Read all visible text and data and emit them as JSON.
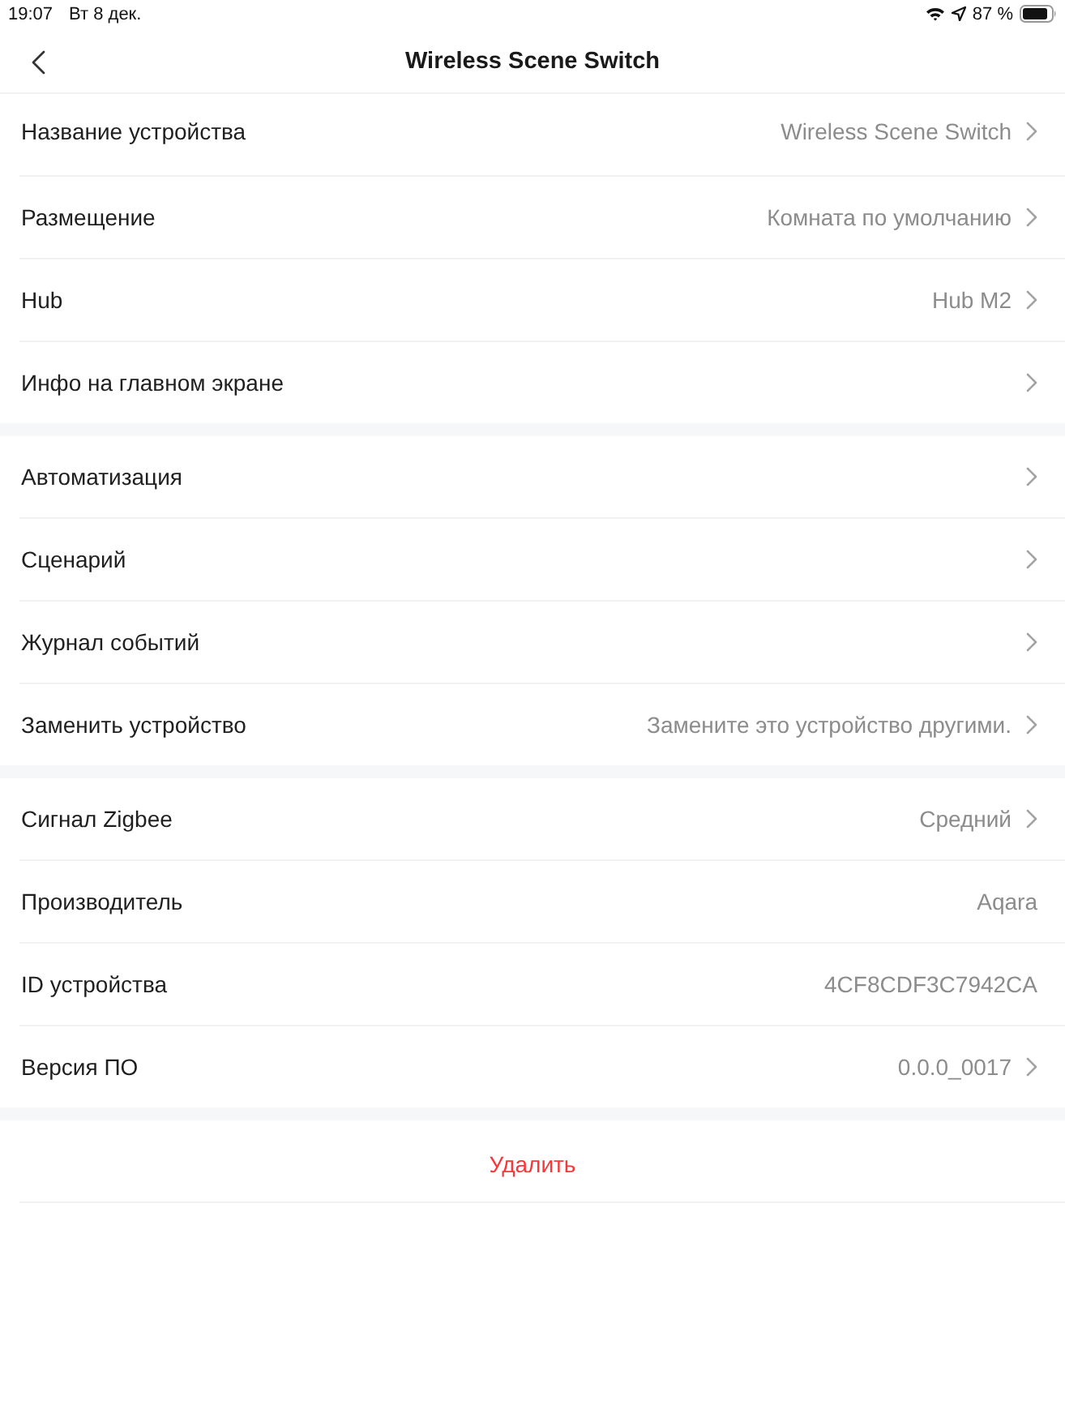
{
  "status_bar": {
    "time": "19:07",
    "date": "Вт 8 дек.",
    "battery": "87 %"
  },
  "header": {
    "title": "Wireless Scene Switch"
  },
  "groups": [
    {
      "rows": [
        {
          "label": "Название устройства",
          "value": "Wireless Scene Switch",
          "chevron": true
        },
        {
          "label": "Размещение",
          "value": "Комната по умолчанию",
          "chevron": true
        },
        {
          "label": "Hub",
          "value": "Hub M2",
          "chevron": true
        },
        {
          "label": "Инфо на главном экране",
          "chevron": true
        }
      ]
    },
    {
      "rows": [
        {
          "label": "Автоматизация",
          "chevron": true
        },
        {
          "label": "Сценарий",
          "chevron": true
        },
        {
          "label": "Журнал событий",
          "chevron": true
        },
        {
          "label": "Заменить устройство",
          "value": "Замените это устройство другими.",
          "chevron": true
        }
      ]
    },
    {
      "rows": [
        {
          "label": "Сигнал Zigbee",
          "value": "Средний",
          "chevron": true
        },
        {
          "label": "Производитель",
          "value": "Aqara",
          "chevron": false
        },
        {
          "label": "ID устройства",
          "value": "4CF8CDF3C7942CA",
          "chevron": false
        },
        {
          "label": "Версия ПО",
          "value": "0.0.0_0017",
          "chevron": true
        }
      ]
    }
  ],
  "delete_button": {
    "label": "Удалить"
  }
}
